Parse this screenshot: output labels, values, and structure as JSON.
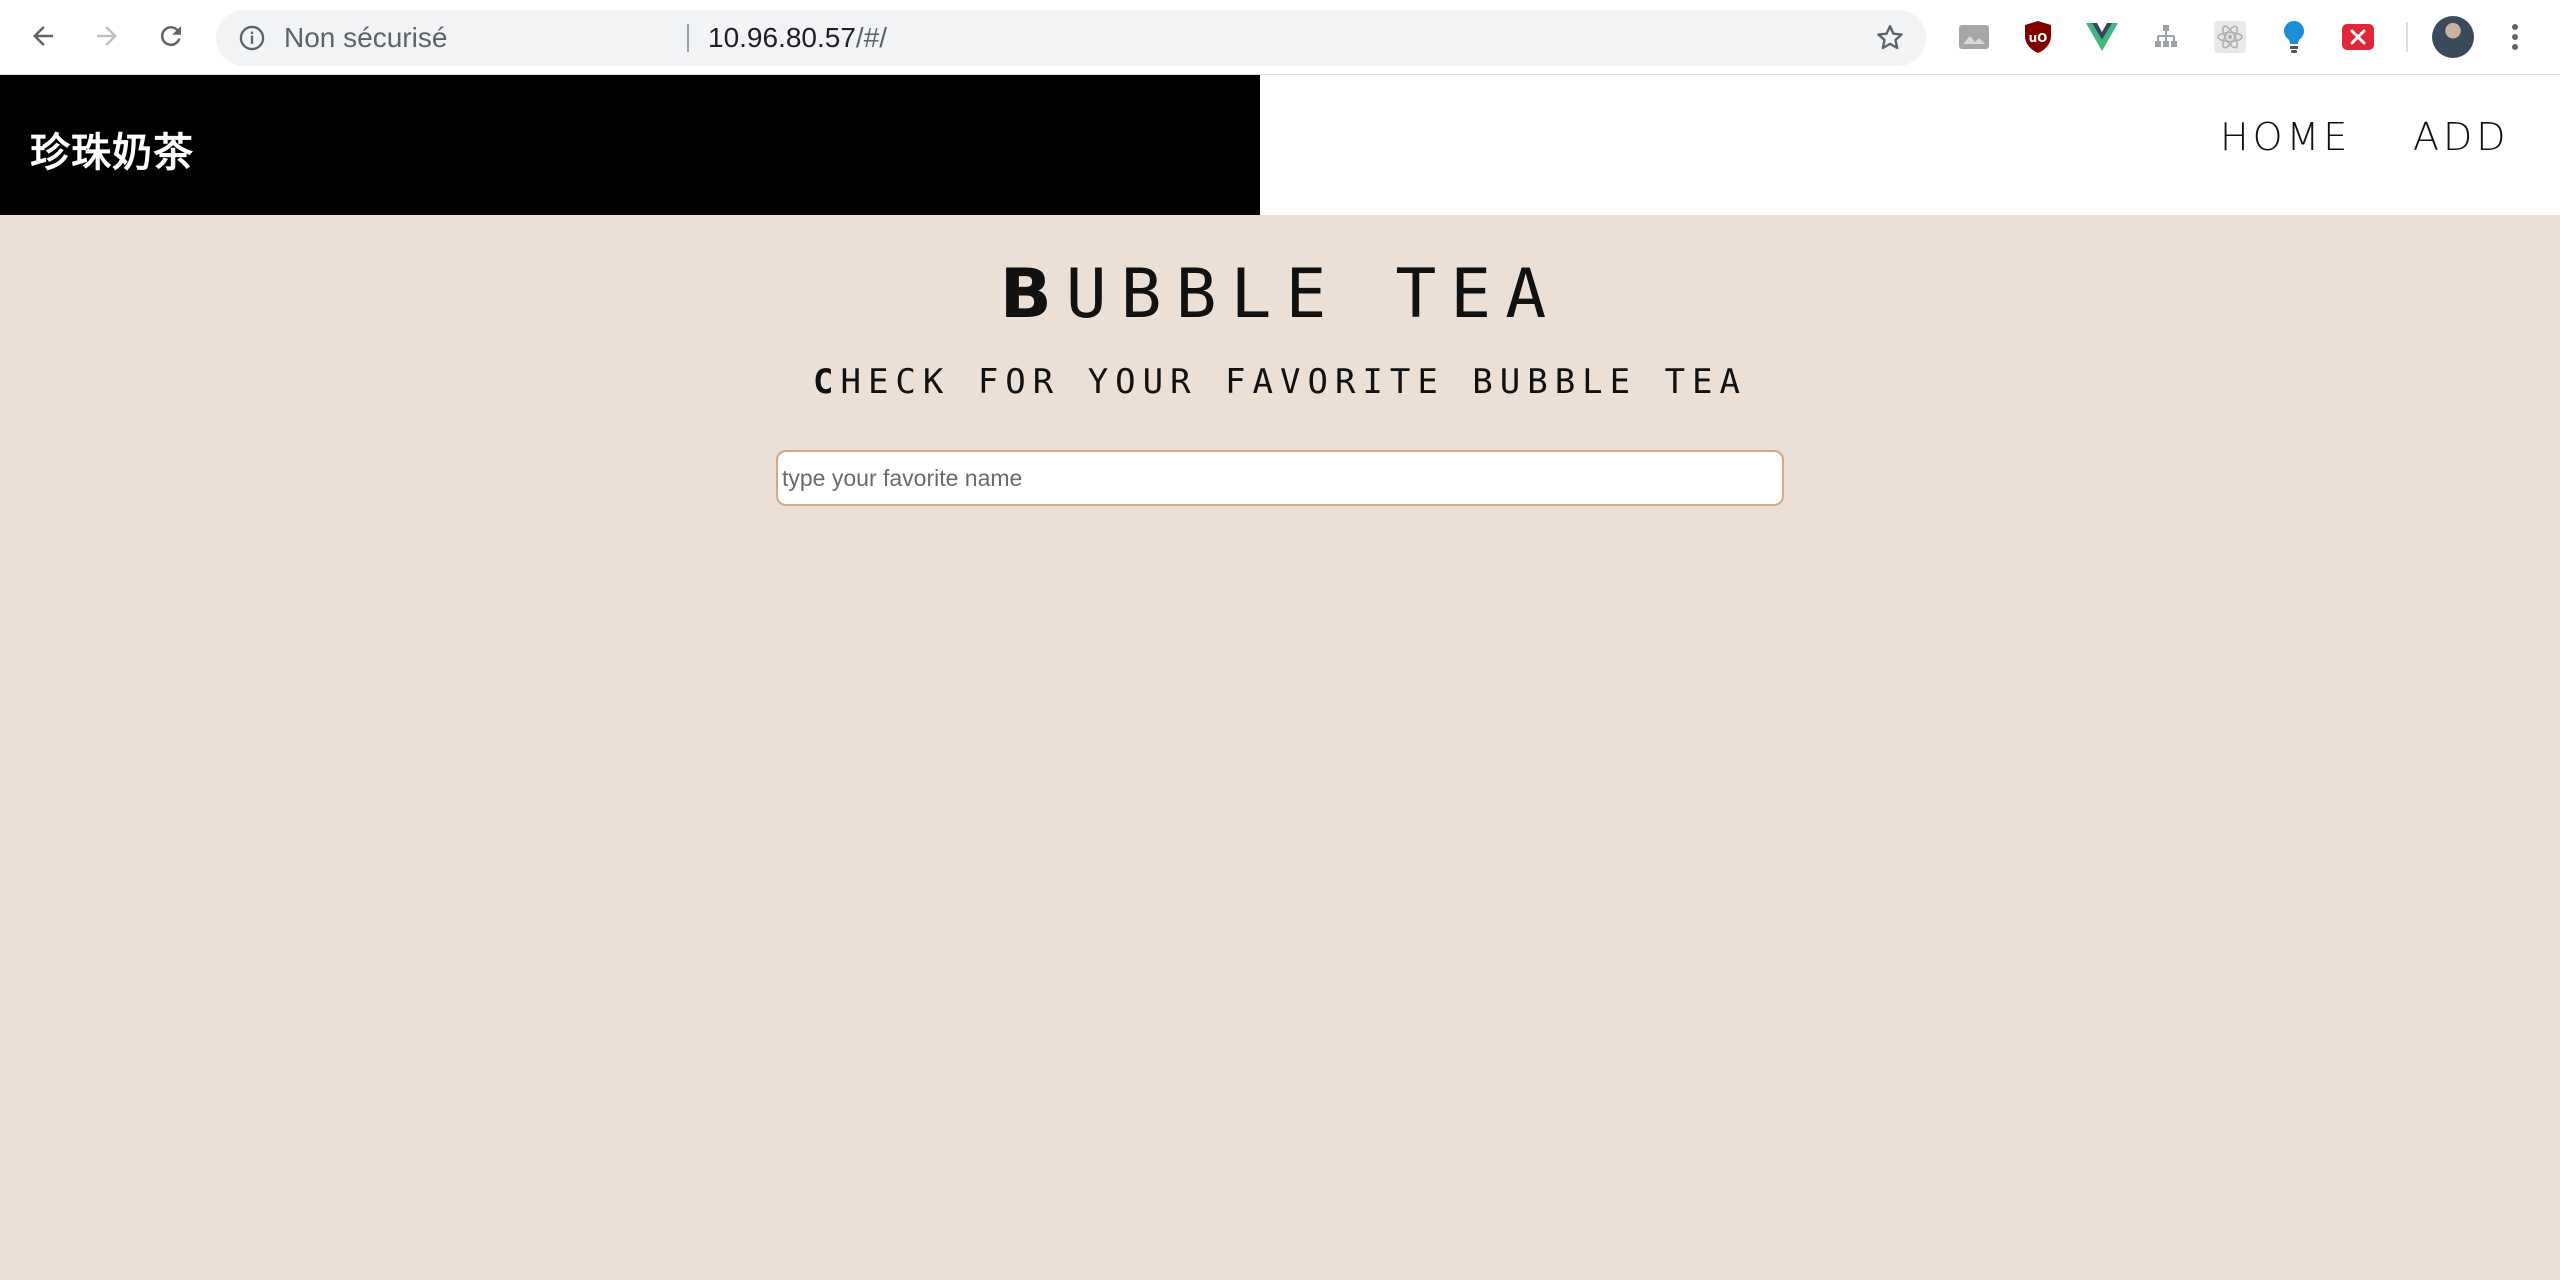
{
  "browser": {
    "security_label": "Non sécurisé",
    "url_host": "10.96.80.57",
    "url_path": "/#/",
    "icons": [
      "back-arrow-icon",
      "forward-arrow-icon",
      "reload-icon",
      "info-icon",
      "star-icon",
      "menu-icon"
    ],
    "extensions": [
      "image-extension-icon",
      "ublock-origin-icon",
      "vue-devtools-icon",
      "sitemap-extension-icon",
      "react-devtools-icon",
      "lightbulb-extension-icon",
      "close-extension-icon"
    ]
  },
  "header": {
    "brand": "珍珠奶茶",
    "nav": {
      "home": "HOME",
      "add": "ADD"
    }
  },
  "hero": {
    "title_first": "B",
    "title_rest": "UBBLE TEA",
    "subtitle_first": "C",
    "subtitle_rest": "HECK FOR YOUR FAVORITE BUBBLE TEA"
  },
  "search": {
    "placeholder": "type your favorite name",
    "value": ""
  },
  "colors": {
    "page_background": "#ecdfd5",
    "brand_background": "#000000",
    "input_border": "#d0a88a"
  }
}
